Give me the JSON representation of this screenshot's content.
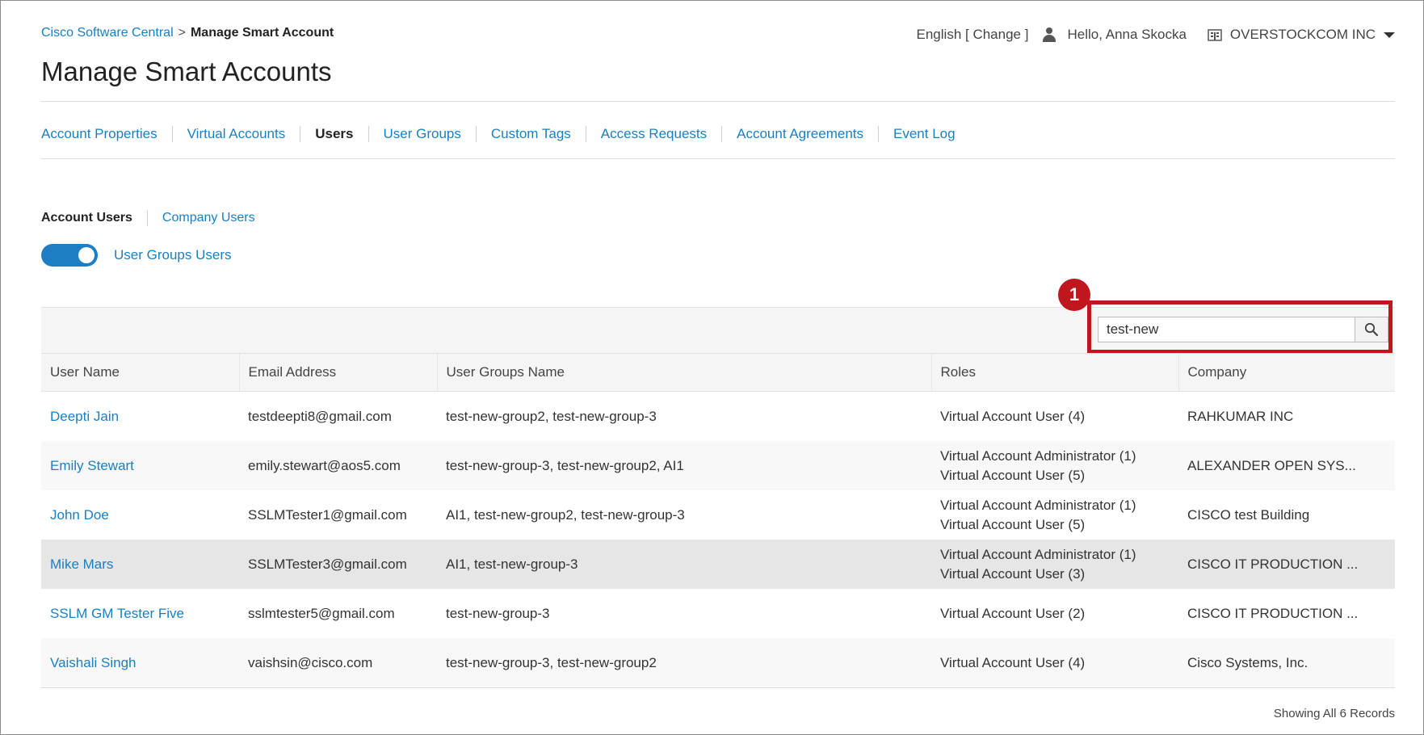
{
  "header": {
    "breadcrumb_link": "Cisco Software Central",
    "breadcrumb_sep": ">",
    "breadcrumb_current": "Manage Smart Account",
    "title": "Manage Smart Accounts",
    "language": "English [",
    "language_change": "Change",
    "language_close": "]",
    "greeting": "Hello, Anna Skocka",
    "company": "OVERSTOCKCOM INC"
  },
  "tabs": [
    {
      "label": "Account Properties",
      "active": false
    },
    {
      "label": "Virtual Accounts",
      "active": false
    },
    {
      "label": "Users",
      "active": true
    },
    {
      "label": "User Groups",
      "active": false
    },
    {
      "label": "Custom Tags",
      "active": false
    },
    {
      "label": "Access Requests",
      "active": false
    },
    {
      "label": "Account Agreements",
      "active": false
    },
    {
      "label": "Event Log",
      "active": false
    }
  ],
  "subtabs": [
    {
      "label": "Account Users",
      "active": true
    },
    {
      "label": "Company Users",
      "active": false
    }
  ],
  "toggle": {
    "label": "User Groups Users",
    "on": true
  },
  "search": {
    "value": "test-new"
  },
  "callout": {
    "number": "1"
  },
  "table": {
    "columns": [
      "User Name",
      "Email Address",
      "User Groups Name",
      "Roles",
      "Company"
    ],
    "rows": [
      {
        "name": "Deepti Jain",
        "email": "testdeepti8@gmail.com",
        "groups": "test-new-group2, test-new-group-3",
        "role1": "Virtual Account User (4)",
        "role2": "",
        "company": "RAHKUMAR INC"
      },
      {
        "name": "Emily Stewart",
        "email": "emily.stewart@aos5.com",
        "groups": "test-new-group-3, test-new-group2, AI1",
        "role1": "Virtual Account Administrator (1)",
        "role2": "Virtual Account User (5)",
        "company": "ALEXANDER OPEN SYS..."
      },
      {
        "name": "John Doe",
        "email": "SSLMTester1@gmail.com",
        "groups": "AI1, test-new-group2, test-new-group-3",
        "role1": "Virtual Account Administrator (1)",
        "role2": "Virtual Account User (5)",
        "company": "CISCO test Building"
      },
      {
        "name": "Mike Mars",
        "email": "SSLMTester3@gmail.com",
        "groups": "AI1, test-new-group-3",
        "role1": "Virtual Account Administrator (1)",
        "role2": "Virtual Account User (3)",
        "company": "CISCO IT PRODUCTION ..."
      },
      {
        "name": "SSLM GM Tester Five",
        "email": "sslmtester5@gmail.com",
        "groups": "test-new-group-3",
        "role1": "Virtual Account User (2)",
        "role2": "",
        "company": "CISCO IT PRODUCTION ..."
      },
      {
        "name": "Vaishali Singh",
        "email": "vaishsin@cisco.com",
        "groups": "test-new-group-3, test-new-group2",
        "role1": "Virtual Account User (4)",
        "role2": "",
        "company": "Cisco Systems, Inc."
      }
    ]
  },
  "footer": {
    "records": "Showing All 6 Records"
  },
  "colors": {
    "link": "#1a7fc1",
    "callout": "#c0161d",
    "toggle": "#1d7ec3"
  }
}
